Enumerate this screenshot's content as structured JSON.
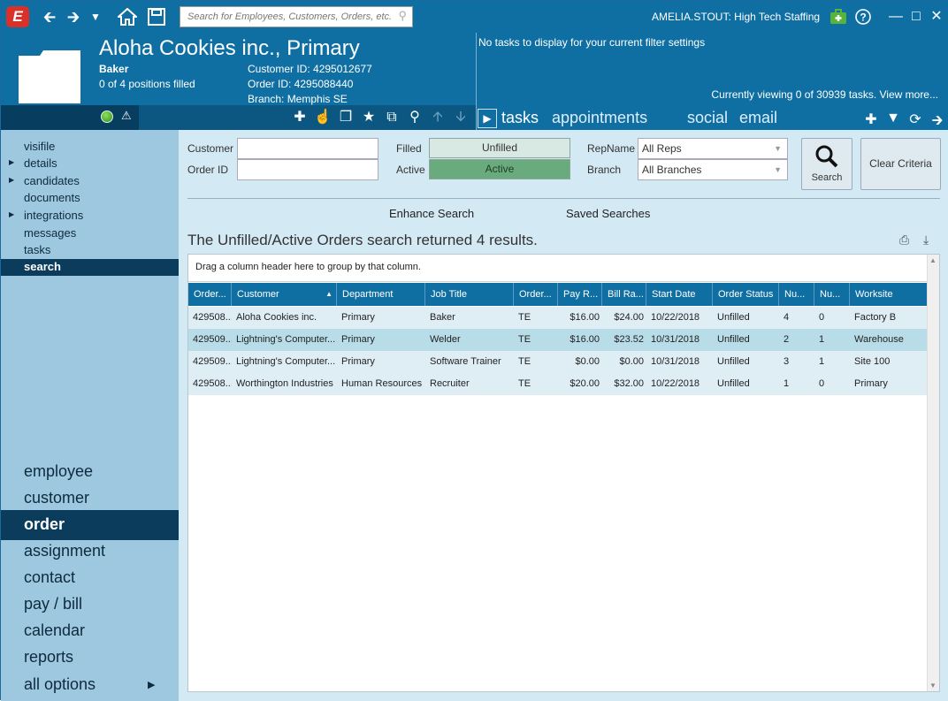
{
  "app": {
    "logo_letter": "E",
    "search_placeholder": "Search for Employees, Customers, Orders, etc.",
    "user": "AMELIA.STOUT: High Tech Staffing"
  },
  "header": {
    "company": "Aloha Cookies inc., Primary",
    "role": "Baker",
    "positions": "0 of 4 positions filled",
    "customer_id": "Customer ID: 4295012677",
    "order_id": "Order ID: 4295088440",
    "branch": "Branch: Memphis SE"
  },
  "tasks": {
    "empty_message": "No tasks to display for your current filter settings",
    "viewing": "Currently viewing 0 of 30939 tasks. View more...",
    "tabs": [
      "tasks",
      "appointments",
      "social",
      "email"
    ]
  },
  "sidebar": {
    "items": [
      {
        "label": "visifile",
        "expandable": false,
        "active": false
      },
      {
        "label": "details",
        "expandable": true,
        "active": false
      },
      {
        "label": "candidates",
        "expandable": true,
        "active": false
      },
      {
        "label": "documents",
        "expandable": false,
        "active": false
      },
      {
        "label": "integrations",
        "expandable": true,
        "active": false
      },
      {
        "label": "messages",
        "expandable": false,
        "active": false
      },
      {
        "label": "tasks",
        "expandable": false,
        "active": false
      },
      {
        "label": "search",
        "expandable": false,
        "active": true
      }
    ],
    "modules": [
      "employee",
      "customer",
      "order",
      "assignment",
      "contact",
      "pay / bill",
      "calendar",
      "reports",
      "all options"
    ],
    "active_module": "order"
  },
  "criteria": {
    "customer_label": "Customer",
    "customer_value": "",
    "order_id_label": "Order ID",
    "order_id_value": "",
    "filled_label": "Filled",
    "filled_value": "Unfilled",
    "active_label": "Active",
    "active_value": "Active",
    "repname_label": "RepName",
    "repname_value": "All Reps",
    "branch_label": "Branch",
    "branch_value": "All Branches",
    "search_btn": "Search",
    "clear_btn": "Clear Criteria",
    "enhance": "Enhance Search",
    "saved": "Saved Searches"
  },
  "results": {
    "summary": "The Unfilled/Active Orders search returned 4 results.",
    "group_hint": "Drag a column header here to group by that column.",
    "columns": [
      "Order...",
      "Customer",
      "Department",
      "Job Title",
      "Order...",
      "Pay R...",
      "Bill Ra...",
      "Start Date",
      "Order Status",
      "Nu...",
      "Nu...",
      "Worksite"
    ],
    "rows": [
      [
        "429508...",
        "Aloha Cookies inc.",
        "Primary",
        "Baker",
        "TE",
        "$16.00",
        "$24.00",
        "10/22/2018",
        "Unfilled",
        "4",
        "0",
        "Factory B"
      ],
      [
        "429509...",
        "Lightning's Computer...",
        "Primary",
        "Welder",
        "TE",
        "$16.00",
        "$23.52",
        "10/31/2018",
        "Unfilled",
        "2",
        "1",
        "Warehouse"
      ],
      [
        "429509...",
        "Lightning's Computer...",
        "Primary",
        "Software Trainer",
        "TE",
        "$0.00",
        "$0.00",
        "10/31/2018",
        "Unfilled",
        "3",
        "1",
        "Site 100"
      ],
      [
        "429508...",
        "Worthington Industries",
        "Human Resources",
        "Recruiter",
        "TE",
        "$20.00",
        "$32.00",
        "10/22/2018",
        "Unfilled",
        "1",
        "0",
        "Primary"
      ]
    ],
    "selected_row": 1
  },
  "colors": {
    "brand_blue": "#0f6fa3",
    "sidebar_bg": "#9ec8df",
    "main_bg": "#d3e9f3",
    "active_green": "#6aab7e",
    "selected_row": "#b8dde8"
  }
}
